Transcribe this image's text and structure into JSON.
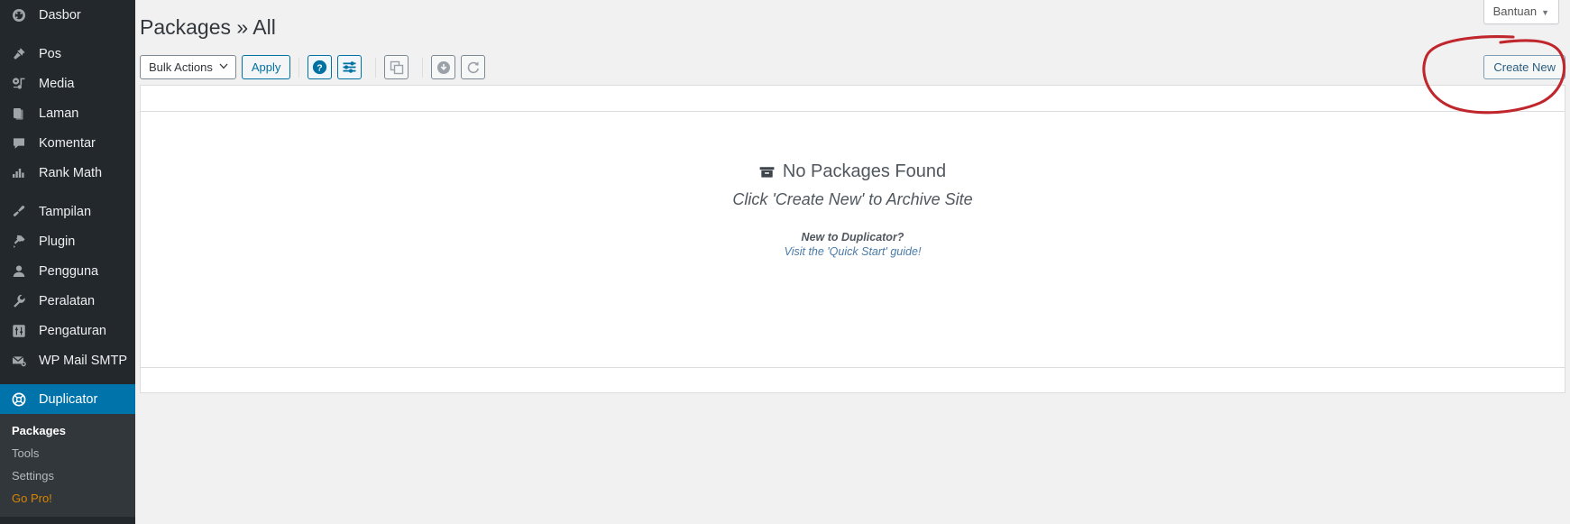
{
  "sidebar": {
    "items": [
      {
        "label": "Dasbor",
        "icon": "dashboard-icon",
        "sep_after": true
      },
      {
        "label": "Pos",
        "icon": "pin-icon",
        "sep_after": false
      },
      {
        "label": "Media",
        "icon": "media-icon",
        "sep_after": false
      },
      {
        "label": "Laman",
        "icon": "pages-icon",
        "sep_after": false
      },
      {
        "label": "Komentar",
        "icon": "comments-icon",
        "sep_after": false
      },
      {
        "label": "Rank Math",
        "icon": "rankmath-icon",
        "sep_after": true
      },
      {
        "label": "Tampilan",
        "icon": "appearance-icon",
        "sep_after": false
      },
      {
        "label": "Plugin",
        "icon": "plugin-icon",
        "sep_after": false
      },
      {
        "label": "Pengguna",
        "icon": "users-icon",
        "sep_after": false
      },
      {
        "label": "Peralatan",
        "icon": "tools-icon",
        "sep_after": false
      },
      {
        "label": "Pengaturan",
        "icon": "settings-icon",
        "sep_after": false
      },
      {
        "label": "WP Mail SMTP",
        "icon": "mail-icon",
        "sep_after": true
      },
      {
        "label": "Duplicator",
        "icon": "duplicator-icon",
        "sep_after": false,
        "active": true
      }
    ],
    "submenu": [
      {
        "label": "Packages",
        "current": true
      },
      {
        "label": "Tools",
        "current": false
      },
      {
        "label": "Settings",
        "current": false
      },
      {
        "label": "Go Pro!",
        "current": false,
        "style": "gopro"
      }
    ],
    "active_color": "#0073aa",
    "gopro_color": "#d98500"
  },
  "header": {
    "help_tab_label": "Bantuan",
    "help_tab_caret": "▼",
    "page_title": "Packages » All"
  },
  "toolbar": {
    "bulk_actions_label": "Bulk Actions",
    "bulk_actions_caret": "⌄",
    "apply_label": "Apply",
    "buttons": [
      {
        "name": "help-icon",
        "title": "Help"
      },
      {
        "name": "filter-icon",
        "title": "Filter"
      },
      {
        "name": "copy-icon",
        "title": "Copy"
      },
      {
        "name": "download-icon",
        "title": "Download"
      },
      {
        "name": "restore-icon",
        "title": "Restore"
      }
    ],
    "create_new_label": "Create New"
  },
  "empty_state": {
    "box_icon": "archive-box-icon",
    "title": "No Packages Found",
    "subtitle": "Click 'Create New' to Archive Site",
    "small_heading": "New to Duplicator?",
    "link_text": "Visit the 'Quick Start' guide!",
    "link_color": "#4a7ba7"
  },
  "annotation": {
    "name": "red-circle-annotation",
    "color": "#c0272d",
    "target": "Create New"
  }
}
